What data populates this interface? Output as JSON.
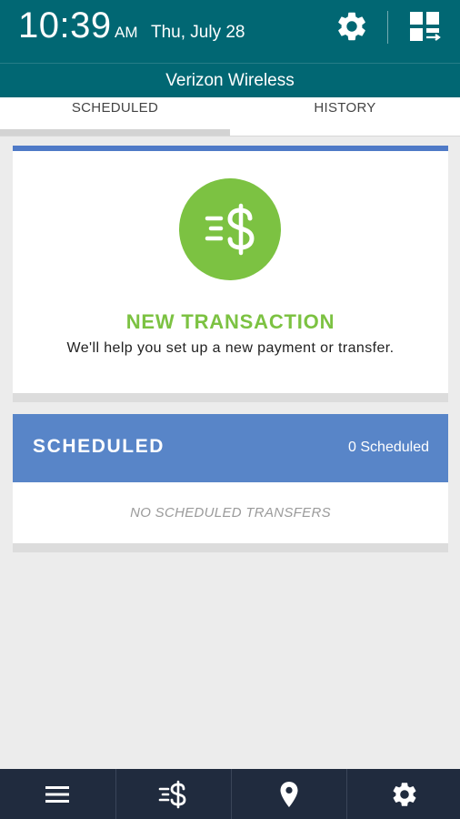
{
  "status_bar": {
    "time": "10:39",
    "ampm": "AM",
    "date": "Thu, July 28",
    "icons": [
      "gear-icon",
      "multiwindow-icon"
    ]
  },
  "carrier": {
    "name": "Verizon Wireless"
  },
  "tabs": [
    {
      "label": "SCHEDULED",
      "selected": true
    },
    {
      "label": "HISTORY",
      "selected": false
    }
  ],
  "new_transaction": {
    "icon": "transfer-dollar-icon",
    "title": "NEW TRANSACTION",
    "subtitle": "We'll help you set up a new payment or transfer."
  },
  "scheduled": {
    "title": "SCHEDULED",
    "count_label": "0 Scheduled",
    "empty_message": "NO SCHEDULED TRANSFERS"
  },
  "bottom_nav": {
    "items": [
      {
        "icon": "menu-icon"
      },
      {
        "icon": "transfer-dollar-icon"
      },
      {
        "icon": "location-pin-icon"
      },
      {
        "icon": "gear-icon"
      }
    ]
  },
  "colors": {
    "status_bar": "#016773",
    "accent_green": "#7cc242",
    "accent_blue": "#5885c8",
    "bottom_nav": "#202b3e"
  }
}
